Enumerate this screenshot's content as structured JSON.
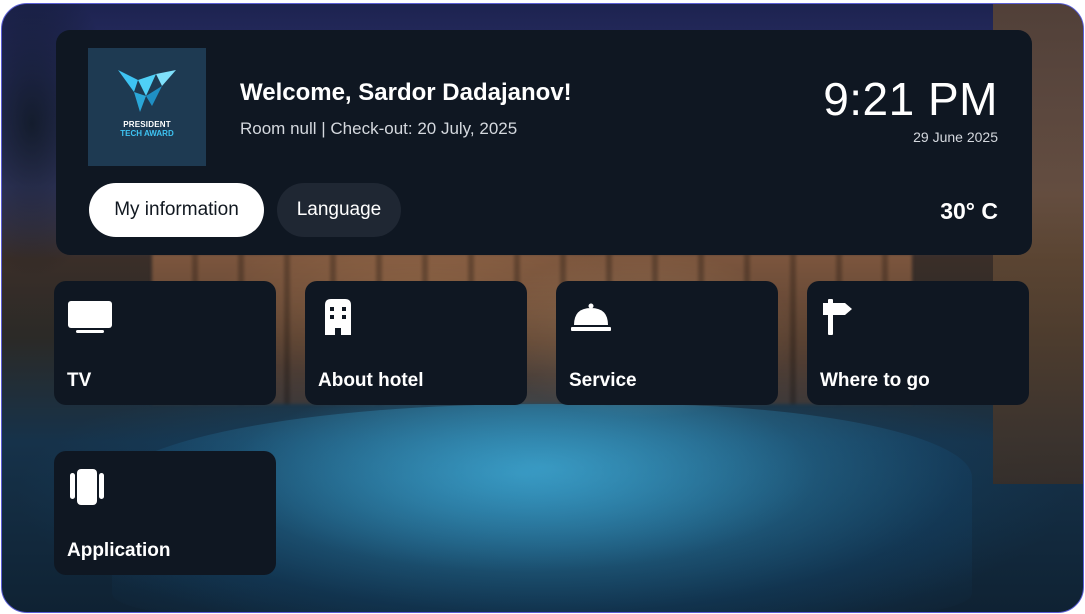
{
  "header": {
    "logo": {
      "line1": "PRESIDENT",
      "line2": "TECH AWARD",
      "icon": "bird-logo-icon",
      "color": "#3ec3f2"
    },
    "welcome": "Welcome, Sardor Dadajanov!",
    "room_info": "Room null | Check-out: 20 July, 2025",
    "time": "9:21 PM",
    "date": "29 June 2025",
    "temperature": "30° C",
    "buttons": {
      "my_information": "My information",
      "language": "Language"
    }
  },
  "tiles": [
    {
      "label": "TV",
      "icon": "tv-icon"
    },
    {
      "label": "About hotel",
      "icon": "building-icon"
    },
    {
      "label": "Service",
      "icon": "service-bell-icon"
    },
    {
      "label": "Where to go",
      "icon": "signpost-icon"
    },
    {
      "label": "Application",
      "icon": "apps-icon"
    }
  ],
  "colors": {
    "card": "#0f1722",
    "accent_border": "#5b5fd6",
    "active_pill": "#ffffff"
  }
}
